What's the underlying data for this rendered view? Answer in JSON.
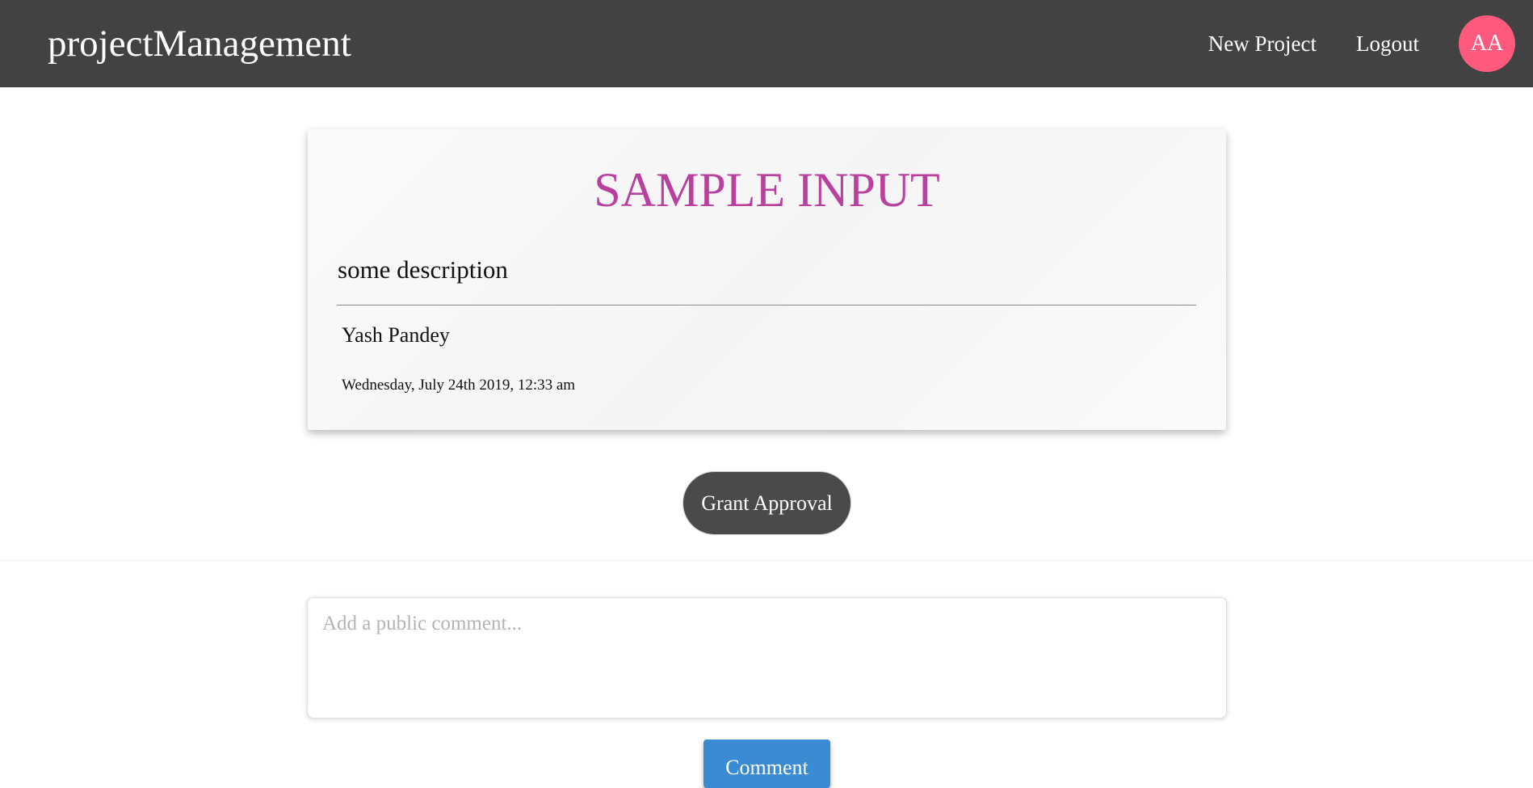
{
  "navbar": {
    "brand": "projectManagement",
    "links": [
      "New Project",
      "Logout"
    ],
    "avatar_initials": "AA",
    "background_color": "#424242",
    "avatar_color": "#ff5a7e"
  },
  "project": {
    "title": "SAMPLE INPUT",
    "description": "some description",
    "author": "Yash Pandey",
    "date": "Wednesday, July 24th 2019, 12:33 am",
    "title_color": "#b9409e"
  },
  "actions": {
    "grant_label": "Grant Approval"
  },
  "comments": {
    "placeholder": "Add a public comment...",
    "submit_label": "Comment",
    "submit_color": "#3a8bd1"
  }
}
